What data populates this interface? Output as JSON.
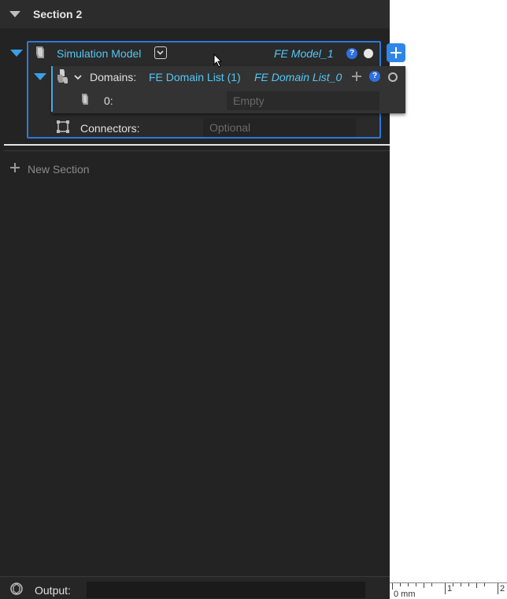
{
  "section": {
    "title": "Section 2"
  },
  "simulation_model": {
    "label": "Simulation Model",
    "value": "FE Model_1",
    "help": "?"
  },
  "domains": {
    "label": "Domains:",
    "type": "FE Domain List (1)",
    "value": "FE Domain List_0",
    "help": "?",
    "item_index": "0:",
    "item_placeholder": "Empty"
  },
  "connectors": {
    "label": "Connectors:",
    "placeholder": "Optional"
  },
  "new_section": {
    "label": "New Section"
  },
  "output": {
    "label": "Output:"
  },
  "ruler": {
    "label": "0 mm",
    "labels": [
      "1",
      "2"
    ]
  },
  "colors": {
    "accent": "#2f86e8",
    "cyan_text": "#52c8f5",
    "panel_bg": "#232323"
  }
}
